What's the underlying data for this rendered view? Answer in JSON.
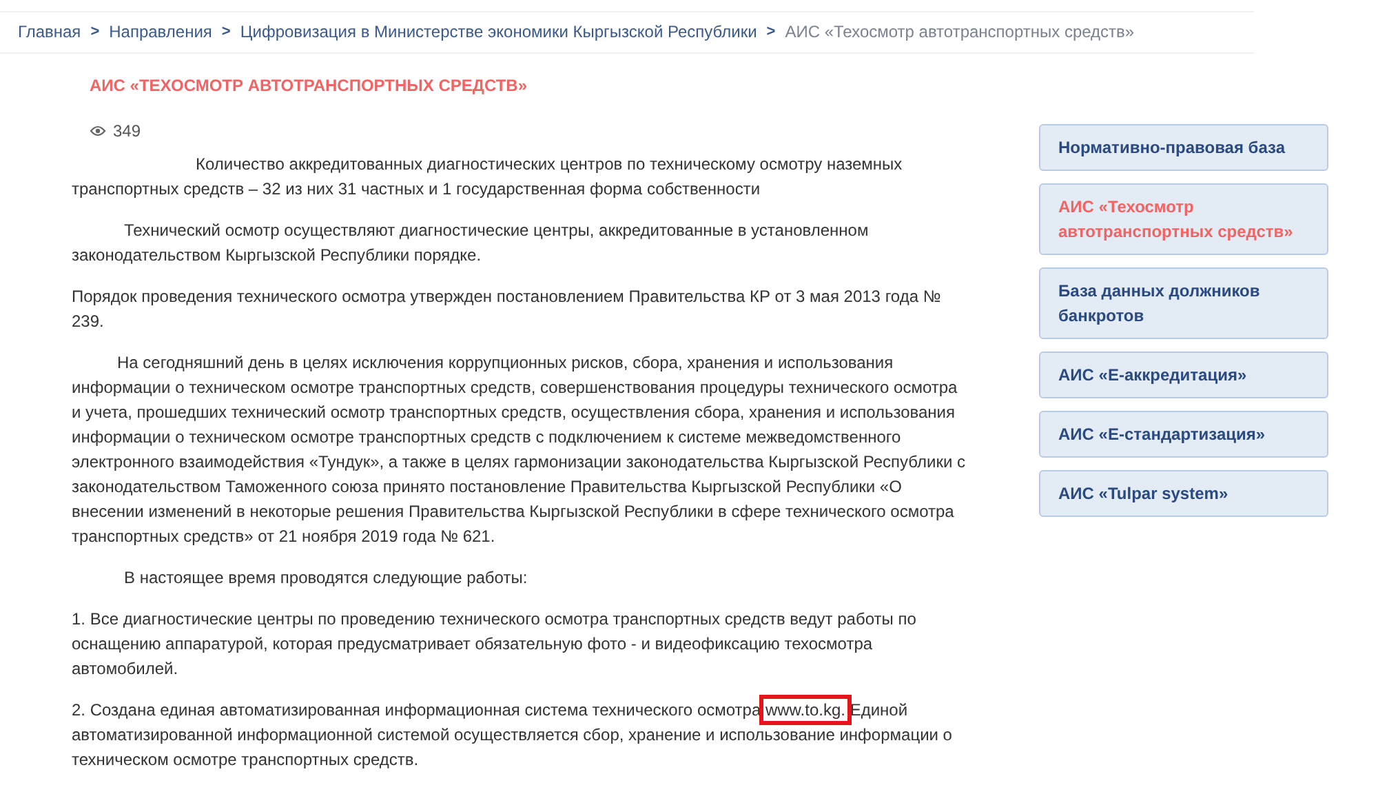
{
  "breadcrumbs": [
    {
      "label": "Главная",
      "current": false
    },
    {
      "label": "Направления",
      "current": false
    },
    {
      "label": "Цифровизация в Министерстве экономики Кыргызской Республики",
      "current": false
    },
    {
      "label": "АИС «Техосмотр автотранспортных средств»",
      "current": true
    }
  ],
  "breadcrumb_separator": ">",
  "article": {
    "title": "АИС «ТЕХОСМОТР АВТОТРАНСПОРТНЫХ СРЕДСТВ»",
    "views": "349",
    "paragraphs": [
      {
        "text": "Количество аккредитованных диагностических центров по техническому осмотру наземных транспортных средств – 32 из них 31 частных и 1 государственная форма собственности"
      },
      {
        "text": "Технический осмотр осуществляют диагностические центры, аккредитованные в установленном законодательством Кыргызской Республики порядке."
      },
      {
        "text": "Порядок проведения технического осмотра утвержден постановлением Правительства КР от 3 мая 2013 года № 239."
      },
      {
        "text": "На сегодняшний день в целях исключения коррупционных рисков, сбора, хранения и использования информации о техническом осмотре транспортных средств, совершенствования процедуры технического осмотра и учета, прошедших технический осмотр транспортных средств, осуществления сбора, хранения и использования информации о техническом осмотре транспортных средств с подключением к системе межведомственного электронного взаимодействия «Тундук», а также в целях гармонизации законодательства Кыргызской Республики с законодательством Таможенного союза  принято постановление Правительства Кыргызской Республики «О внесении изменений в некоторые решения Правительства Кыргызской Республики в сфере технического осмотра транспортных средств» от 21 ноября 2019 года № 621."
      },
      {
        "text": "В настоящее время проводятся следующие работы:"
      },
      {
        "text": "1. Все диагностические центры по проведению технического осмотра транспортных средств ведут работы по оснащению аппаратурой, которая предусматривает обязательную фото - и видеофиксацию техосмотра автомобилей."
      },
      {
        "text": "2. Создана единая автоматизированная информационная система технического осмотра",
        "link": {
          "label": "www.to.kg.",
          "highlighted": true
        },
        "after": "Единой автоматизированной информационной системой осуществляется сбор, хранение и использование информации о техническом осмотре транспортных средств."
      }
    ]
  },
  "sidebar": {
    "items": [
      {
        "label": "Нормативно-правовая база",
        "selected": false
      },
      {
        "label": "АИС «Техосмотр автотранспортных средств»",
        "selected": true
      },
      {
        "label": "База данных должников банкротов",
        "selected": false
      },
      {
        "label": "АИС «E-аккредитация»",
        "selected": false
      },
      {
        "label": "АИС «E-стандартизация»",
        "selected": false
      },
      {
        "label": "АИС «Tulpar system»",
        "selected": false
      }
    ]
  }
}
